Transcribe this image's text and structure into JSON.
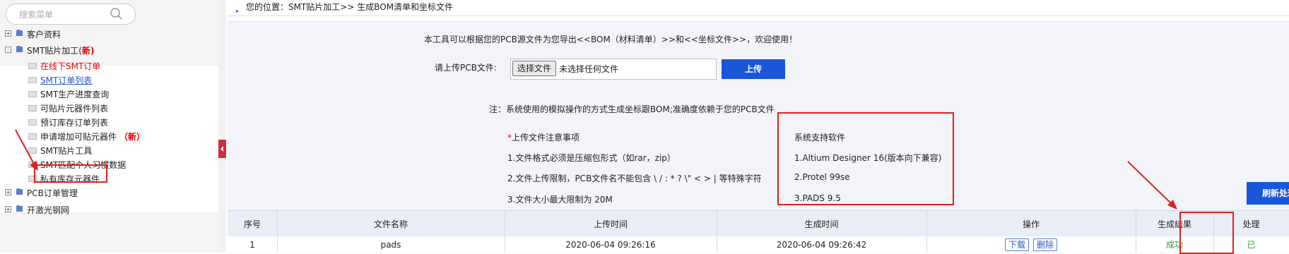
{
  "sidebar": {
    "search_placeholder": "搜索菜单",
    "groups": [
      {
        "label": "客户资料",
        "toggle": "+"
      },
      {
        "label": "SMT贴片加工(",
        "badge": "新)",
        "toggle": "-"
      },
      {
        "label": "PCB订单管理",
        "toggle": "+"
      },
      {
        "label": "开激光钢网",
        "toggle": "+"
      }
    ],
    "smt_items": [
      {
        "label": "在线下SMT订单"
      },
      {
        "label": "SMT订单列表"
      },
      {
        "label": "SMT生产进度查询"
      },
      {
        "label": "可贴片元器件列表"
      },
      {
        "label": "预订库存订单列表"
      },
      {
        "label": "申请增加可贴元器件",
        "badge": "（新）"
      },
      {
        "label": "SMT贴片工具"
      },
      {
        "label": "SMT匹配个人习惯数据"
      },
      {
        "label": "私有库存元器件"
      }
    ]
  },
  "breadcrumb": "您的位置：SMT贴片加工>> 生成BOM清单和坐标文件",
  "intro": "本工具可以根据您的PCB源文件为您导出<<BOM（材料清单）>>和<<坐标文件>>，欢迎使用！",
  "upload": {
    "label": "请上传PCB文件:",
    "choose_btn": "选择文件",
    "no_file": "未选择任何文件",
    "submit": "上传"
  },
  "note": "注：系统使用的模拟操作的方式生成坐标跟BOM;准确度依赖于您的PCB文件",
  "tips": {
    "title": "上传文件注意事项",
    "star": "*",
    "items": [
      "1.文件格式必须是压缩包形式（如rar，zip）",
      "2.文件上传限制，PCB文件名不能包含 \\ / : * ? \\\" < > | 等特殊字符",
      "3.文件大小最大限制为 20M"
    ]
  },
  "supported": {
    "title": "系统支持软件",
    "items": [
      "1.Altium Designer 16(版本向下兼容)",
      "2.Protel 99se",
      "3.PADS 9.5"
    ]
  },
  "refresh_btn": "刷新处理",
  "table": {
    "headers": [
      "序号",
      "文件名称",
      "上传时间",
      "生成时间",
      "操作",
      "生成结果",
      "处理"
    ],
    "rows": [
      {
        "index": "1",
        "filename": "pads",
        "upload_time": "2020-06-04 09:26:16",
        "gen_time": "2020-06-04 09:26:42",
        "download": "下载",
        "delete": "删除",
        "result": "成功",
        "status": "已"
      }
    ]
  },
  "colors": {
    "accent": "#1a56d9",
    "highlight": "#e0201f",
    "success": "#2d9e35"
  }
}
